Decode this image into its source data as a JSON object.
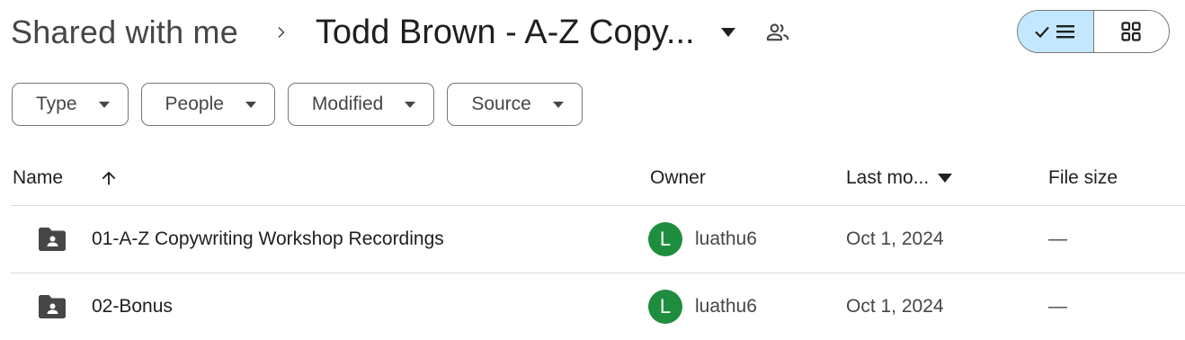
{
  "breadcrumb": {
    "root": "Shared with me",
    "current": "Todd Brown - A-Z Copy..."
  },
  "view_toggle": {
    "active": "list",
    "options": [
      "list",
      "grid"
    ]
  },
  "filters": [
    {
      "label": "Type"
    },
    {
      "label": "People"
    },
    {
      "label": "Modified"
    },
    {
      "label": "Source"
    }
  ],
  "table": {
    "columns": {
      "name": "Name",
      "owner": "Owner",
      "last_modified": "Last mo...",
      "file_size": "File size"
    },
    "sort": {
      "column": "name",
      "direction": "ascending"
    },
    "rows": [
      {
        "name": "01-A-Z Copywriting Workshop Recordings",
        "owner_initial": "L",
        "owner": "luathu6",
        "modified": "Oct 1, 2024",
        "size": "—"
      },
      {
        "name": "02-Bonus",
        "owner_initial": "L",
        "owner": "luathu6",
        "modified": "Oct 1, 2024",
        "size": "—"
      }
    ]
  },
  "colors": {
    "active_toggle": "#c2e7ff",
    "avatar": "#1e8e3e",
    "border": "#747775"
  }
}
